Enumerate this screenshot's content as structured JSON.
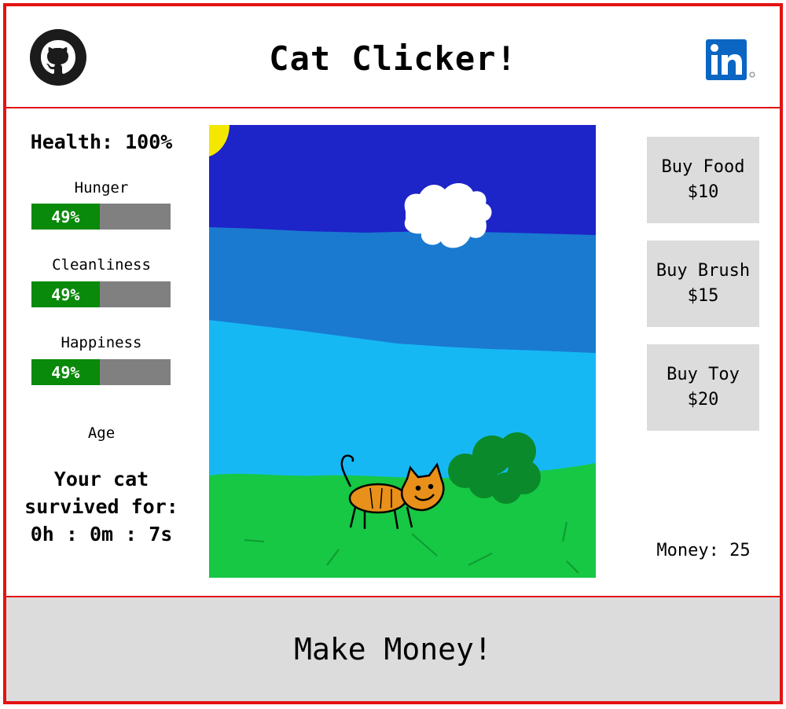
{
  "app": {
    "title": "Cat Clicker!"
  },
  "links": {
    "github_icon": "github-icon",
    "linkedin_icon": "linkedin-icon",
    "linkedin_text": "in"
  },
  "stats": {
    "health": "Health: 100%",
    "bars": [
      {
        "label": "Hunger",
        "value_text": "49%",
        "fraction": 0.49
      },
      {
        "label": "Cleanliness",
        "value_text": "49%",
        "fraction": 0.49
      },
      {
        "label": "Happiness",
        "value_text": "49%",
        "fraction": 0.49
      }
    ],
    "age_label": "Age",
    "survived_line1": "Your cat",
    "survived_line2": "survived for:",
    "survived_time": "0h : 0m : 7s"
  },
  "shop": {
    "items": [
      {
        "name": "Buy Food",
        "price": "$10"
      },
      {
        "name": "Buy Brush",
        "price": "$15"
      },
      {
        "name": "Buy Toy",
        "price": "$20"
      }
    ],
    "money": "Money: 25"
  },
  "actions": {
    "make_money": "Make Money!"
  },
  "colors": {
    "border": "#e41212",
    "bar_fill": "#0a8a0a",
    "bar_empty": "#808080",
    "button_bg": "#dcdcdc",
    "sky_top": "#1d24c8",
    "sky_mid": "#1a7ad0",
    "sky_low": "#16b8f4",
    "grass": "#16c844",
    "cat": "#e8901a"
  }
}
